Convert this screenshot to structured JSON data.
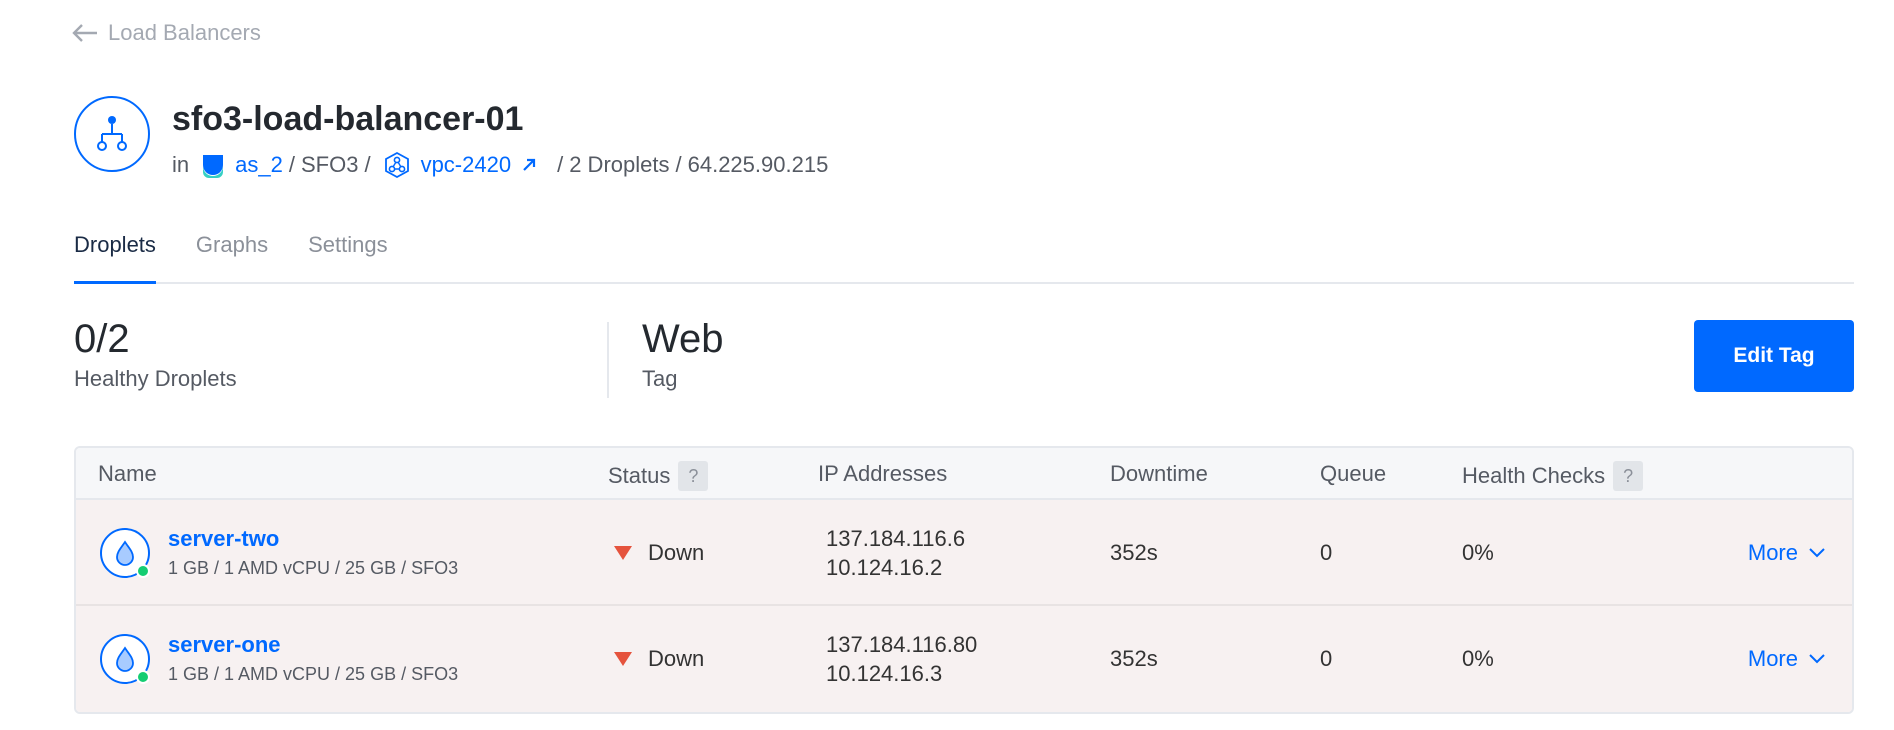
{
  "breadcrumb": {
    "back_label": "Load Balancers"
  },
  "header": {
    "title": "sfo3-load-balancer-01",
    "in_label": "in",
    "team": "as_2",
    "region": "SFO3",
    "vpc": "vpc-2420",
    "droplet_count": "2 Droplets",
    "ip": "64.225.90.215",
    "separator": "/"
  },
  "tabs": [
    {
      "label": "Droplets",
      "active": true
    },
    {
      "label": "Graphs",
      "active": false
    },
    {
      "label": "Settings",
      "active": false
    }
  ],
  "stats": {
    "healthy_value": "0/2",
    "healthy_label": "Healthy Droplets",
    "tag_value": "Web",
    "tag_label": "Tag",
    "edit_tag_label": "Edit Tag"
  },
  "table": {
    "headers": {
      "name": "Name",
      "status": "Status",
      "ips": "IP Addresses",
      "downtime": "Downtime",
      "queue": "Queue",
      "health": "Health Checks",
      "help": "?"
    },
    "rows": [
      {
        "name": "server-two",
        "specs": "1 GB / 1 AMD vCPU / 25 GB / SFO3",
        "status": "Down",
        "public_ip": "137.184.116.6",
        "private_ip": "10.124.16.2",
        "downtime": "352s",
        "queue": "0",
        "health": "0%",
        "more": "More"
      },
      {
        "name": "server-one",
        "specs": "1 GB / 1 AMD vCPU / 25 GB / SFO3",
        "status": "Down",
        "public_ip": "137.184.116.80",
        "private_ip": "10.124.16.3",
        "downtime": "352s",
        "queue": "0",
        "health": "0%",
        "more": "More"
      }
    ]
  },
  "colors": {
    "accent": "#0069ff",
    "down": "#e5533d",
    "online": "#15cd72"
  },
  "icons": [
    "arrow-left-icon",
    "load-balancer-icon",
    "team-icon",
    "vpc-icon",
    "external-link-icon",
    "droplet-icon",
    "status-down-icon",
    "chevron-down-icon"
  ]
}
